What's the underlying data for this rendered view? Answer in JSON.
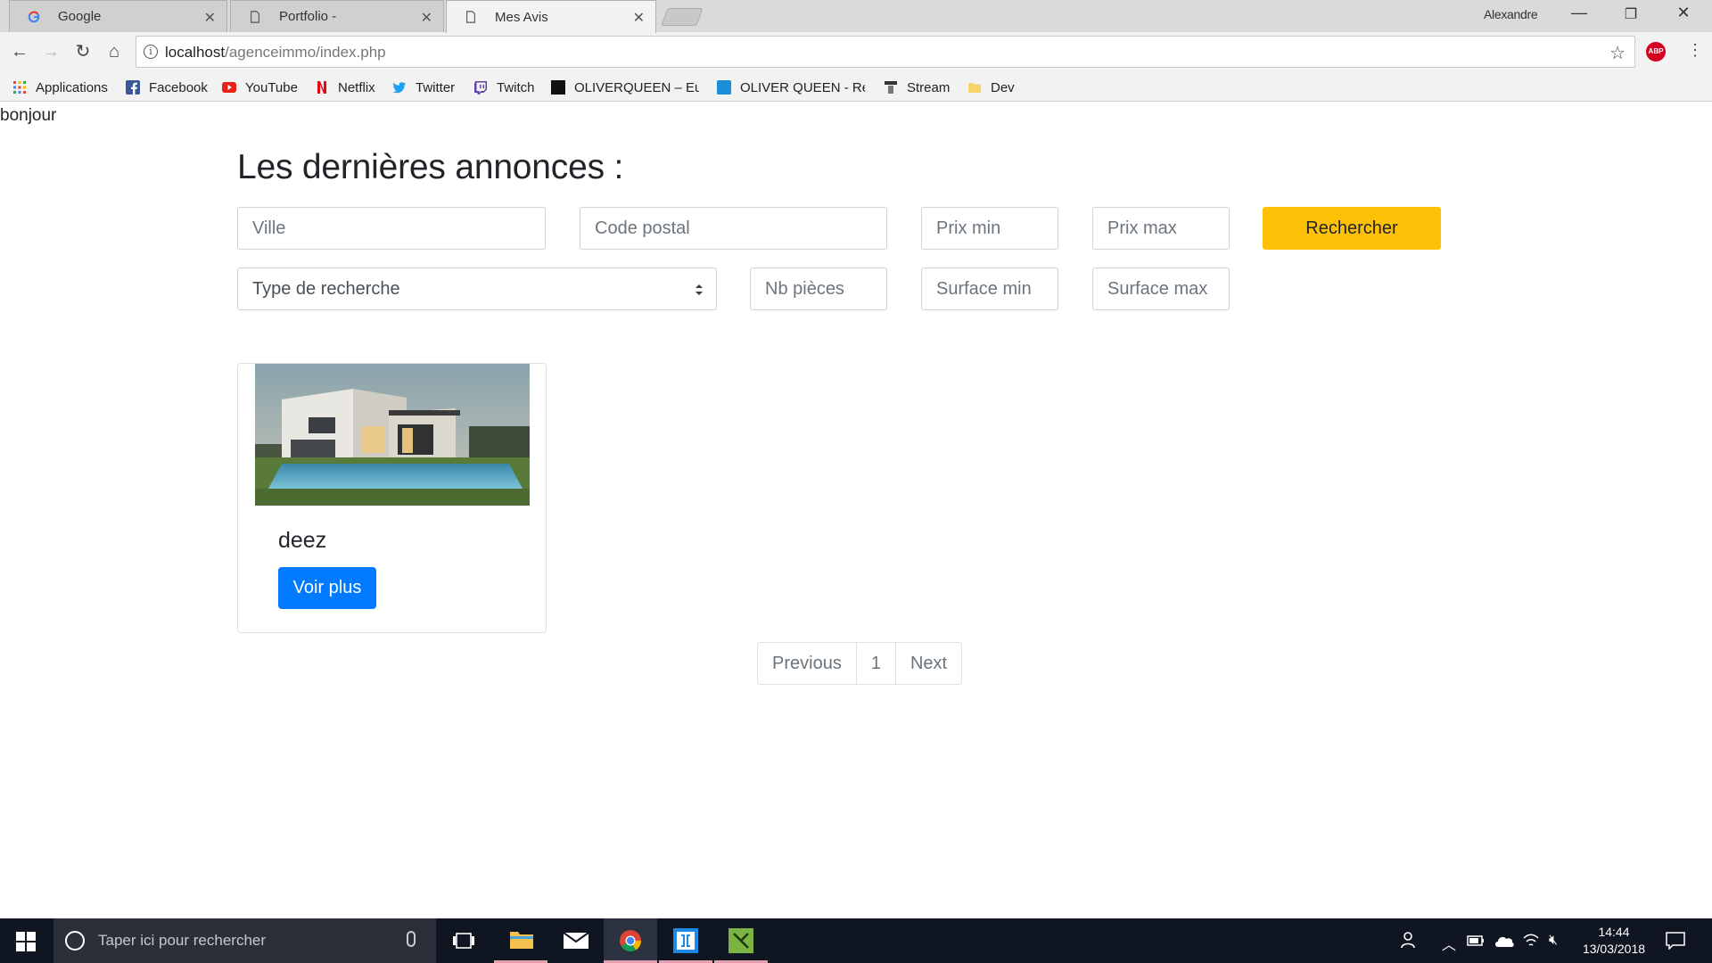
{
  "browser": {
    "tabs": [
      {
        "label": "Google"
      },
      {
        "label": "Portfolio -"
      },
      {
        "label": "Mes Avis"
      }
    ],
    "user": "Alexandre",
    "url_host": "localhost",
    "url_path": "/agenceimmo/index.php",
    "abp_label": "ABP",
    "bookmarks": [
      {
        "label": "Applications"
      },
      {
        "label": "Facebook"
      },
      {
        "label": "YouTube"
      },
      {
        "label": "Netflix"
      },
      {
        "label": "Twitter"
      },
      {
        "label": "Twitch"
      },
      {
        "label": "OLIVERQUEEN – Euro"
      },
      {
        "label": "OLIVER QUEEN - Rési"
      },
      {
        "label": "Stream"
      },
      {
        "label": "Dev"
      }
    ]
  },
  "page": {
    "greeting": "bonjour",
    "title": "Les dernières annonces :",
    "search": {
      "ville_placeholder": "Ville",
      "code_postal_placeholder": "Code postal",
      "prix_min_placeholder": "Prix min",
      "prix_max_placeholder": "Prix max",
      "button": "Rechercher",
      "type_select": "Type de recherche",
      "nb_pieces_placeholder": "Nb pièces",
      "surface_min_placeholder": "Surface min",
      "surface_max_placeholder": "Surface max"
    },
    "listings": [
      {
        "title": "deez",
        "button": "Voir plus"
      }
    ],
    "pagination": {
      "previous": "Previous",
      "page": "1",
      "next": "Next"
    }
  },
  "taskbar": {
    "search_placeholder": "Taper ici pour rechercher",
    "time": "14:44",
    "date": "13/03/2018"
  },
  "colors": {
    "search_button": "#ffc107",
    "primary_button": "#007bff",
    "taskbar": "#101522"
  }
}
